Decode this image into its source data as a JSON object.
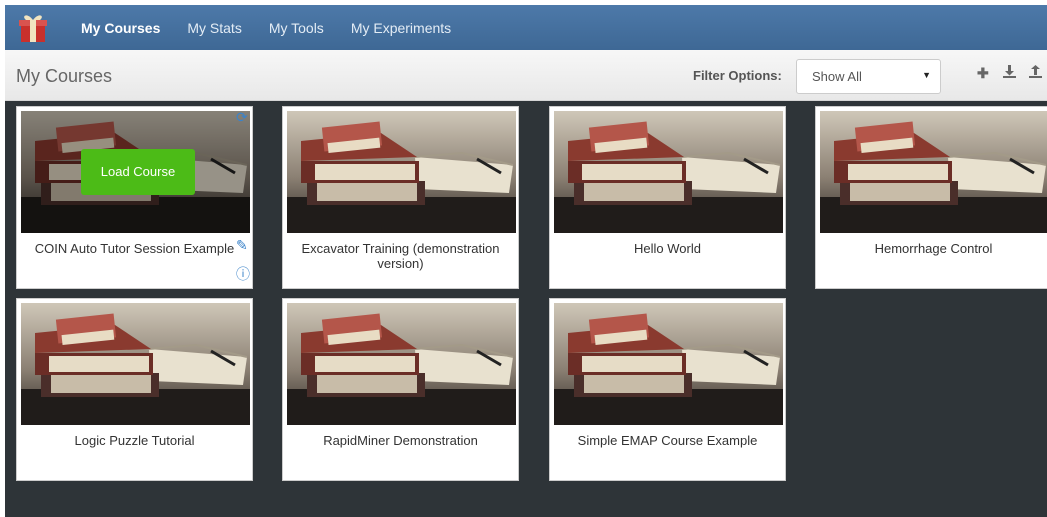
{
  "nav": {
    "items": [
      {
        "label": "My Courses"
      },
      {
        "label": "My Stats"
      },
      {
        "label": "My Tools"
      },
      {
        "label": "My Experiments"
      }
    ]
  },
  "toolbar": {
    "title": "My Courses",
    "filter_label": "Filter Options:",
    "filter_value": "Show All",
    "icons": [
      "plus-icon",
      "download-icon",
      "upload-icon"
    ]
  },
  "courses": [
    {
      "title": "COIN Auto Tutor Session Example",
      "action": "Load Course",
      "icons": [
        "refresh-icon",
        "pencil-icon",
        "info-icon"
      ]
    },
    {
      "title": "Excavator Training (demonstration version)"
    },
    {
      "title": "Hello World"
    },
    {
      "title": "Hemorrhage Control"
    },
    {
      "title": "Logic Puzzle Tutorial"
    },
    {
      "title": "RapidMiner Demonstration"
    },
    {
      "title": "Simple EMAP Course Example"
    }
  ],
  "colors": {
    "navbar": "#4672a2",
    "accent": "#3b83c9",
    "load_button": "#4cbb17",
    "background": "#2e3438"
  }
}
